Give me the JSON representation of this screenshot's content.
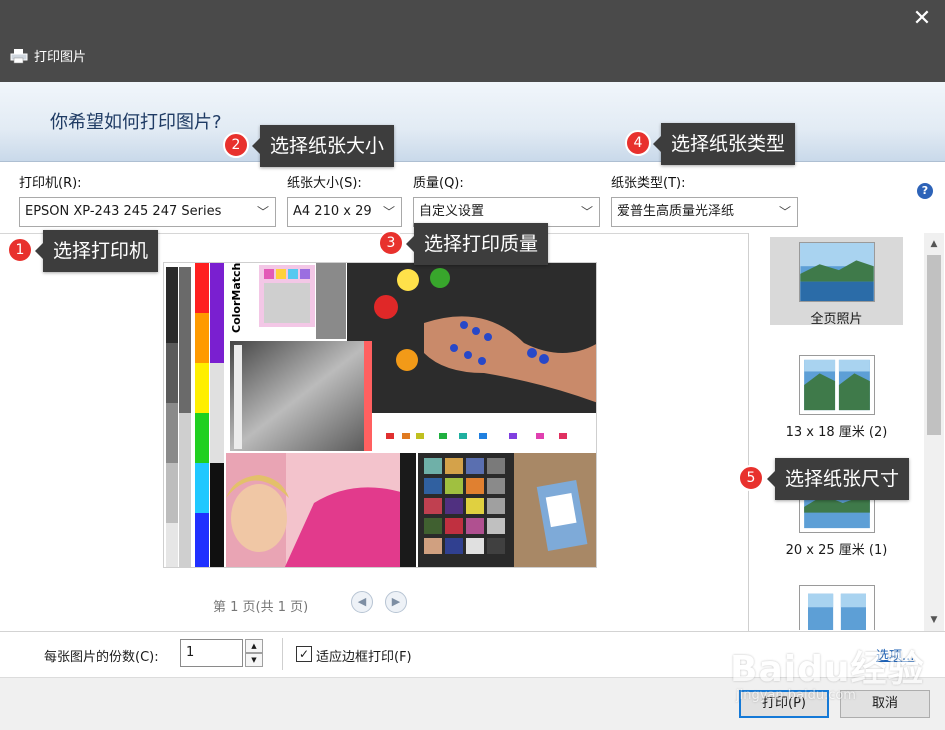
{
  "window": {
    "title": "打印图片",
    "close_label": "✕"
  },
  "header": {
    "heading": "你希望如何打印图片?"
  },
  "fields": {
    "printer": {
      "label": "打印机(R):",
      "value": "EPSON XP-243 245 247 Series"
    },
    "paper_size": {
      "label": "纸张大小(S):",
      "value": "A4 210 x 29"
    },
    "quality": {
      "label": "质量(Q):",
      "value": "自定义设置"
    },
    "paper_type": {
      "label": "纸张类型(T):",
      "value": "爱普生高质量光泽纸"
    },
    "help_label": "?"
  },
  "preview": {
    "page_status": "第 1 页(共 1 页)",
    "prev_label": "◀",
    "next_label": "▶",
    "image_caption": "ColorMatch R"
  },
  "layouts": {
    "items": [
      {
        "label": "全页照片",
        "selected": true
      },
      {
        "label": "13 x 18 厘米 (2)",
        "selected": false
      },
      {
        "label": "20 x 25 厘米 (1)",
        "selected": false
      },
      {
        "label": "",
        "selected": false
      }
    ]
  },
  "bottom": {
    "copies_label": "每张图片的份数(C):",
    "copies_value": "1",
    "fit_label": "适应边框打印(F)",
    "fit_checked": "✓",
    "options_link": "选项..."
  },
  "footer": {
    "print_button": "打印(P)",
    "cancel_button": "取消"
  },
  "callouts": [
    {
      "number": "1",
      "text": "选择打印机"
    },
    {
      "number": "2",
      "text": "选择纸张大小"
    },
    {
      "number": "3",
      "text": "选择打印质量"
    },
    {
      "number": "4",
      "text": "选择纸张类型"
    },
    {
      "number": "5",
      "text": "选择纸张尺寸"
    }
  ],
  "watermark": {
    "main": "Baidu经验",
    "sub": "jingyan.baidu.com"
  },
  "colors": {
    "title_bar": "#4a4a4a",
    "accent": "#1479d7",
    "callout_dot": "#e8312d",
    "callout_box": "#3d3d3d"
  }
}
